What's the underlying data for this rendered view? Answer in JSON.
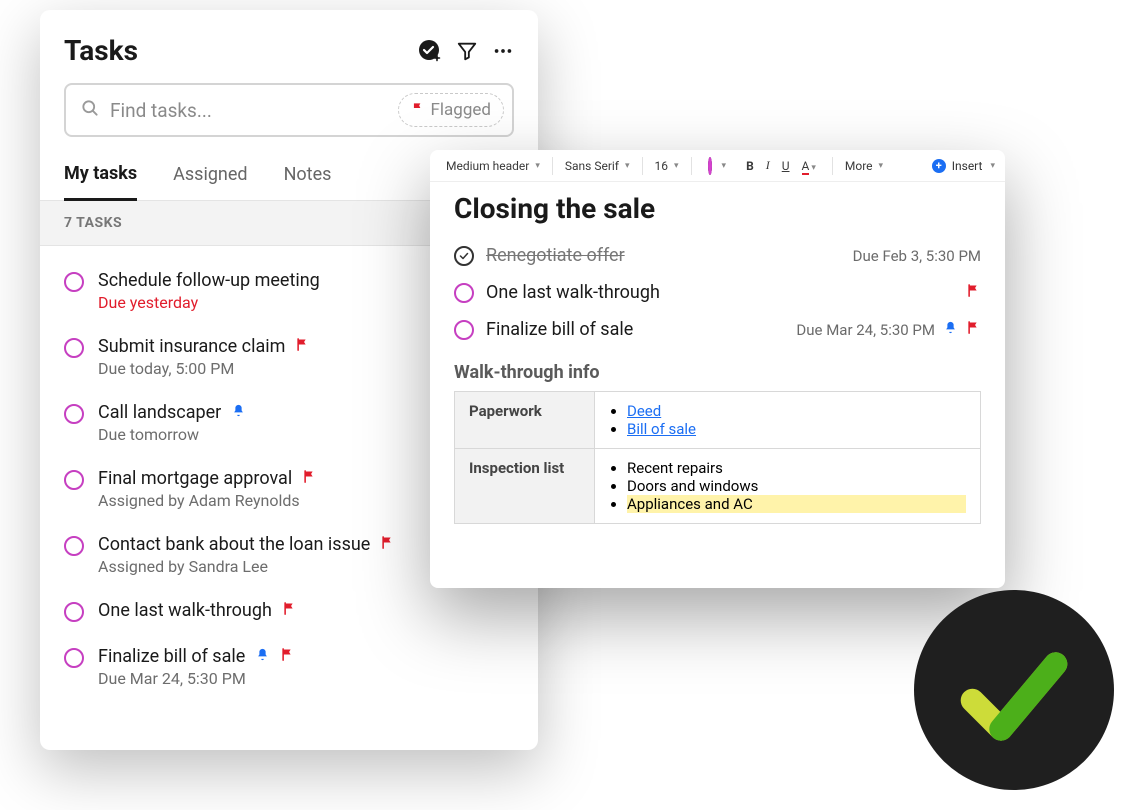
{
  "tasksPanel": {
    "title": "Tasks",
    "search": {
      "placeholder": "Find tasks...",
      "flaggedLabel": "Flagged"
    },
    "tabs": {
      "myTasks": "My tasks",
      "assigned": "Assigned",
      "notes": "Notes"
    },
    "countLabel": "7 TASKS",
    "items": [
      {
        "title": "Schedule follow-up meeting",
        "sub": "Due yesterday",
        "overdue": true
      },
      {
        "title": "Submit insurance claim",
        "sub": "Due today, 5:00 PM",
        "flag": true
      },
      {
        "title": "Call landscaper",
        "sub": "Due tomorrow",
        "bell": true
      },
      {
        "title": "Final mortgage approval",
        "sub": "Assigned by Adam Reynolds",
        "flag": true
      },
      {
        "title": "Contact bank about the loan issue",
        "sub": "Assigned by Sandra Lee",
        "flag": true
      },
      {
        "title": "One last walk-through",
        "flag": true
      },
      {
        "title": "Finalize bill of sale",
        "sub": "Due Mar 24, 5:30 PM",
        "bell": true,
        "flag": true
      }
    ]
  },
  "editor": {
    "toolbar": {
      "style": "Medium header",
      "font": "Sans Serif",
      "size": "16",
      "bold": "B",
      "italic": "I",
      "underline": "U",
      "textColor": "A",
      "more": "More",
      "insert": "Insert"
    },
    "doc": {
      "title": "Closing the sale",
      "tasks": [
        {
          "done": true,
          "title": "Renegotiate offer",
          "due": "Due Feb 3, 5:30 PM"
        },
        {
          "title": "One last walk-through",
          "flag": true
        },
        {
          "title": "Finalize bill of sale",
          "due": "Due Mar 24, 5:30 PM",
          "bell": true,
          "flag": true
        }
      ],
      "section": "Walk-through info",
      "table": {
        "rows": [
          {
            "label": "Paperwork",
            "items": [
              "Deed",
              "Bill of sale"
            ],
            "links": true
          },
          {
            "label": "Inspection list",
            "items": [
              "Recent repairs",
              "Doors and windows",
              "Appliances and AC"
            ],
            "highlightLast": true
          }
        ]
      }
    }
  }
}
